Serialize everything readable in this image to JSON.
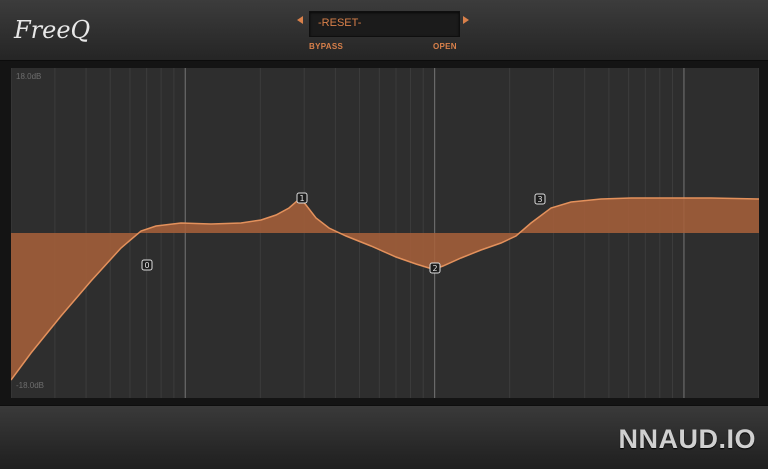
{
  "header": {
    "logo_text": "FreeQ",
    "preset_name": "-RESET-",
    "bypass_label": "BYPASS",
    "open_label": "OPEN"
  },
  "graph": {
    "db_max_label": "18.0dB",
    "db_min_label": "-18.0dB",
    "bands": [
      {
        "id": "0"
      },
      {
        "id": "1"
      },
      {
        "id": "2"
      },
      {
        "id": "3"
      }
    ]
  },
  "footer": {
    "brand": "NNAUD.IO"
  },
  "colors": {
    "accent": "#d9804a",
    "curve_fill": "#a8603a",
    "curve_stroke": "#e3915c",
    "grid_bg": "#2e2e2e"
  }
}
